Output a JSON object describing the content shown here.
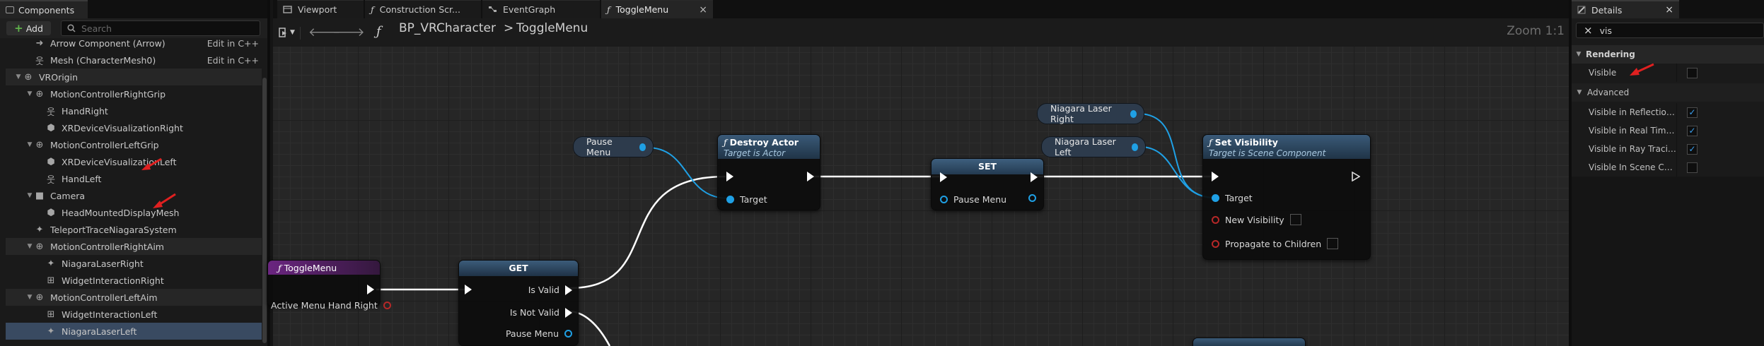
{
  "left_panel": {
    "tab_label": "Components",
    "add_label": "Add",
    "search_placeholder": "Search",
    "tree": [
      {
        "label": "Arrow Component (Arrow)",
        "icon": "arrow-component-icon",
        "indent": 2,
        "right": "Edit in C++"
      },
      {
        "label": "Mesh (CharacterMesh0)",
        "icon": "skeletal-mesh-icon",
        "indent": 2,
        "right": "Edit in C++"
      },
      {
        "label": "VROrigin",
        "icon": "scene-component-icon",
        "indent": 1,
        "expanded": true,
        "category": true
      },
      {
        "label": "MotionControllerRightGrip",
        "icon": "motion-controller-icon",
        "indent": 2,
        "expanded": true
      },
      {
        "label": "HandRight",
        "icon": "skeletal-mesh-icon",
        "indent": 3
      },
      {
        "label": "XRDeviceVisualizationRight",
        "icon": "static-mesh-icon",
        "indent": 3
      },
      {
        "label": "MotionControllerLeftGrip",
        "icon": "motion-controller-icon",
        "indent": 2,
        "expanded": true
      },
      {
        "label": "XRDeviceVisualizationLeft",
        "icon": "static-mesh-icon",
        "indent": 3
      },
      {
        "label": "HandLeft",
        "icon": "skeletal-mesh-icon",
        "indent": 3
      },
      {
        "label": "Camera",
        "icon": "camera-icon",
        "indent": 2,
        "expanded": true
      },
      {
        "label": "HeadMountedDisplayMesh",
        "icon": "static-mesh-icon",
        "indent": 3
      },
      {
        "label": "TeleportTraceNiagaraSystem",
        "icon": "niagara-icon",
        "indent": 2
      },
      {
        "label": "MotionControllerRightAim",
        "icon": "motion-controller-icon",
        "indent": 2,
        "expanded": true,
        "category": true
      },
      {
        "label": "NiagaraLaserRight",
        "icon": "niagara-icon",
        "indent": 3
      },
      {
        "label": "WidgetInteractionRight",
        "icon": "widget-interaction-icon",
        "indent": 3
      },
      {
        "label": "MotionControllerLeftAim",
        "icon": "motion-controller-icon",
        "indent": 2,
        "expanded": true,
        "category": true
      },
      {
        "label": "WidgetInteractionLeft",
        "icon": "widget-interaction-icon",
        "indent": 3
      },
      {
        "label": "NiagaraLaserLeft",
        "icon": "niagara-icon",
        "indent": 3,
        "selected": true
      }
    ]
  },
  "tabs": [
    {
      "label": "Viewport",
      "icon": "viewport-icon"
    },
    {
      "label": "Construction Scr...",
      "icon": "function-icon"
    },
    {
      "label": "EventGraph",
      "icon": "event-graph-icon"
    },
    {
      "label": "ToggleMenu",
      "icon": "function-icon",
      "active": true
    }
  ],
  "breadcrumb": {
    "root": "BP_VRCharacter",
    "separator": ">",
    "current": "ToggleMenu"
  },
  "zoom": "Zoom 1:1",
  "graph": {
    "vars": {
      "pause_menu": "Pause Menu",
      "laser_right": "Niagara Laser Right",
      "laser_left": "Niagara Laser Left"
    },
    "entry": {
      "title": "ToggleMenu",
      "pin": "Active Menu Hand Right"
    },
    "get": {
      "title": "GET",
      "is_valid": "Is Valid",
      "is_not_valid": "Is Not Valid",
      "pin": "Pause Menu"
    },
    "destroy": {
      "title": "Destroy Actor",
      "subtitle": "Target is Actor",
      "target": "Target"
    },
    "set": {
      "title": "SET",
      "pin": "Pause Menu"
    },
    "visibility": {
      "title": "Set Visibility",
      "subtitle": "Target is Scene Component",
      "target": "Target",
      "new_visibility": "New Visibility",
      "propagate": "Propagate to Children"
    }
  },
  "right_panel": {
    "tab_label": "Details",
    "search_value": "vis",
    "categories": [
      {
        "label": "Rendering",
        "rows": [
          {
            "label": "Visible",
            "checked": false
          }
        ]
      },
      {
        "label": "Advanced",
        "rows": [
          {
            "label": "Visible in Reflection...",
            "checked": true
          },
          {
            "label": "Visible in Real Time...",
            "checked": true
          },
          {
            "label": "Visible in Ray Tracing",
            "checked": true
          },
          {
            "label": "Visible In Scene Cap...",
            "checked": false
          }
        ]
      }
    ]
  },
  "colors": {
    "accent": "#1fa0e5",
    "selection": "#394a61",
    "annotation_arrow": "#e02020",
    "function_header": "#7a2a8a",
    "call_header": "#2e4d6c"
  }
}
